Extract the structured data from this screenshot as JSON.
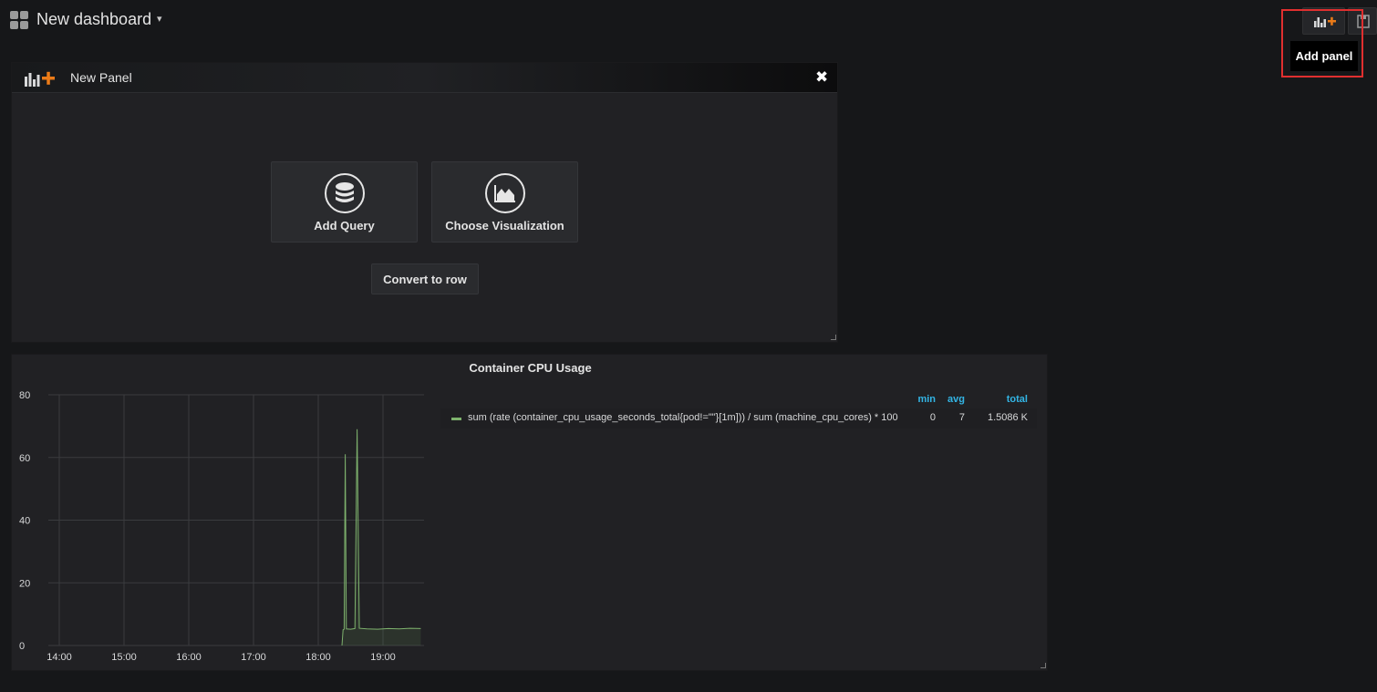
{
  "header": {
    "title": "New dashboard",
    "caret": "▾",
    "add_panel_icon": "add-panel-icon",
    "save_icon": "save-icon",
    "tooltip": "Add panel"
  },
  "new_panel": {
    "title": "New Panel",
    "close": "✖",
    "add_query_label": "Add Query",
    "choose_viz_label": "Choose Visualization",
    "convert_row_label": "Convert to row"
  },
  "graph_panel": {
    "title": "Container CPU Usage",
    "legend": {
      "headers": {
        "min": "min",
        "avg": "avg",
        "total": "total"
      },
      "series": [
        {
          "name": "sum (rate (container_cpu_usage_seconds_total{pod!=\"\"}[1m])) / sum (machine_cpu_cores) * 100",
          "min": "0",
          "avg": "7",
          "total": "1.5086 K",
          "color": "#7eb26d"
        }
      ]
    }
  },
  "chart_data": {
    "type": "line",
    "title": "Container CPU Usage",
    "x_tick_labels": [
      "14:00",
      "15:00",
      "16:00",
      "17:00",
      "18:00",
      "19:00"
    ],
    "y_tick_labels": [
      "0",
      "20",
      "40",
      "60",
      "80"
    ],
    "ylim": [
      0,
      80
    ],
    "grid": true,
    "legend_placement": "right",
    "series": [
      {
        "name": "sum (rate (container_cpu_usage_seconds_total{pod!=\"\"}[1m])) / sum (machine_cpu_cores) * 100",
        "color": "#7eb26d",
        "points": [
          [
            "18:22",
            0
          ],
          [
            "18:23",
            5.0
          ],
          [
            "18:24",
            5.2
          ],
          [
            "18:25",
            61
          ],
          [
            "18:26",
            5.3
          ],
          [
            "18:30",
            5.2
          ],
          [
            "18:34",
            5.4
          ],
          [
            "18:36",
            69
          ],
          [
            "18:38",
            5.5
          ],
          [
            "18:45",
            5.3
          ],
          [
            "18:55",
            5.2
          ],
          [
            "19:05",
            5.4
          ],
          [
            "19:15",
            5.3
          ],
          [
            "19:25",
            5.5
          ],
          [
            "19:35",
            5.4
          ]
        ]
      }
    ]
  }
}
